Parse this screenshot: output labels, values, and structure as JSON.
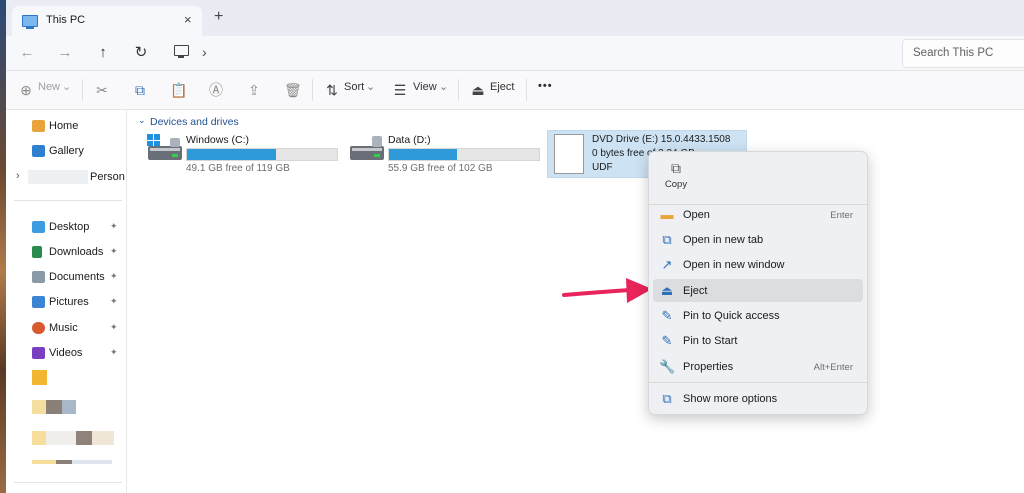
{
  "window": {
    "tab_title": "This PC",
    "tab_close": "×",
    "tab_add": "+"
  },
  "navigation": {
    "back_glyph": "←",
    "forward_glyph": "→",
    "up_glyph": "↑",
    "refresh_glyph": "↻",
    "breadcrumb_chevron": "›",
    "search_placeholder": "Search This PC"
  },
  "toolbar": {
    "new_label": "New",
    "sort_label": "Sort",
    "view_label": "View",
    "eject_label": "Eject",
    "more_glyph": "•••",
    "dropdown_glyph": "⌄"
  },
  "sidebar": {
    "items": [
      {
        "label": "Home",
        "icon": "home-icon",
        "color": "#e8a33a"
      },
      {
        "label": "Gallery",
        "icon": "gallery-icon",
        "color": "#2f7fd1"
      },
      {
        "label": "Person",
        "icon": "onedrive-icon",
        "color": "#ffffff"
      },
      {
        "label": "Desktop",
        "icon": "desktop-icon",
        "color": "#3d9be0"
      },
      {
        "label": "Downloads",
        "icon": "downloads-icon",
        "color": "#2b8a4f"
      },
      {
        "label": "Documents",
        "icon": "documents-icon",
        "color": "#8a9aa8"
      },
      {
        "label": "Pictures",
        "icon": "pictures-icon",
        "color": "#3a86d4"
      },
      {
        "label": "Music",
        "icon": "music-icon",
        "color": "#d8592f"
      },
      {
        "label": "Videos",
        "icon": "videos-icon",
        "color": "#7a3fc1"
      }
    ],
    "pin_glyph": "📌",
    "expand_glyph": "›"
  },
  "content": {
    "group_title": "Devices and drives",
    "group_chevron": "⌄",
    "drives": [
      {
        "name": "Windows (C:)",
        "free": "49.1 GB free of 119 GB",
        "used_fraction": 0.59,
        "icon": "windows-drive-icon"
      },
      {
        "name": "Data (D:)",
        "free": "55.9 GB free of 102 GB",
        "used_fraction": 0.45,
        "icon": "data-drive-icon"
      }
    ],
    "dvd": {
      "name": "DVD Drive (E:) 15.0.4433.1508",
      "free": "0 bytes free of 3.34 GB",
      "fs": "UDF",
      "icon": "dvd-file-icon"
    }
  },
  "context_menu": {
    "copy_label": "Copy",
    "items": [
      {
        "label": "Open",
        "shortcut": "Enter",
        "icon": "folder-open-icon"
      },
      {
        "label": "Open in new tab",
        "shortcut": "",
        "icon": "new-tab-icon"
      },
      {
        "label": "Open in new window",
        "shortcut": "",
        "icon": "new-window-icon"
      },
      {
        "label": "Eject",
        "shortcut": "",
        "icon": "eject-icon"
      },
      {
        "label": "Pin to Quick access",
        "shortcut": "",
        "icon": "pin-icon"
      },
      {
        "label": "Pin to Start",
        "shortcut": "",
        "icon": "pin-start-icon"
      },
      {
        "label": "Properties",
        "shortcut": "Alt+Enter",
        "icon": "wrench-icon"
      },
      {
        "label": "Show more options",
        "shortcut": "",
        "icon": "more-options-icon"
      }
    ]
  },
  "colors": {
    "accent": "#2e9ad8",
    "annotation_arrow": "#e8245a"
  }
}
